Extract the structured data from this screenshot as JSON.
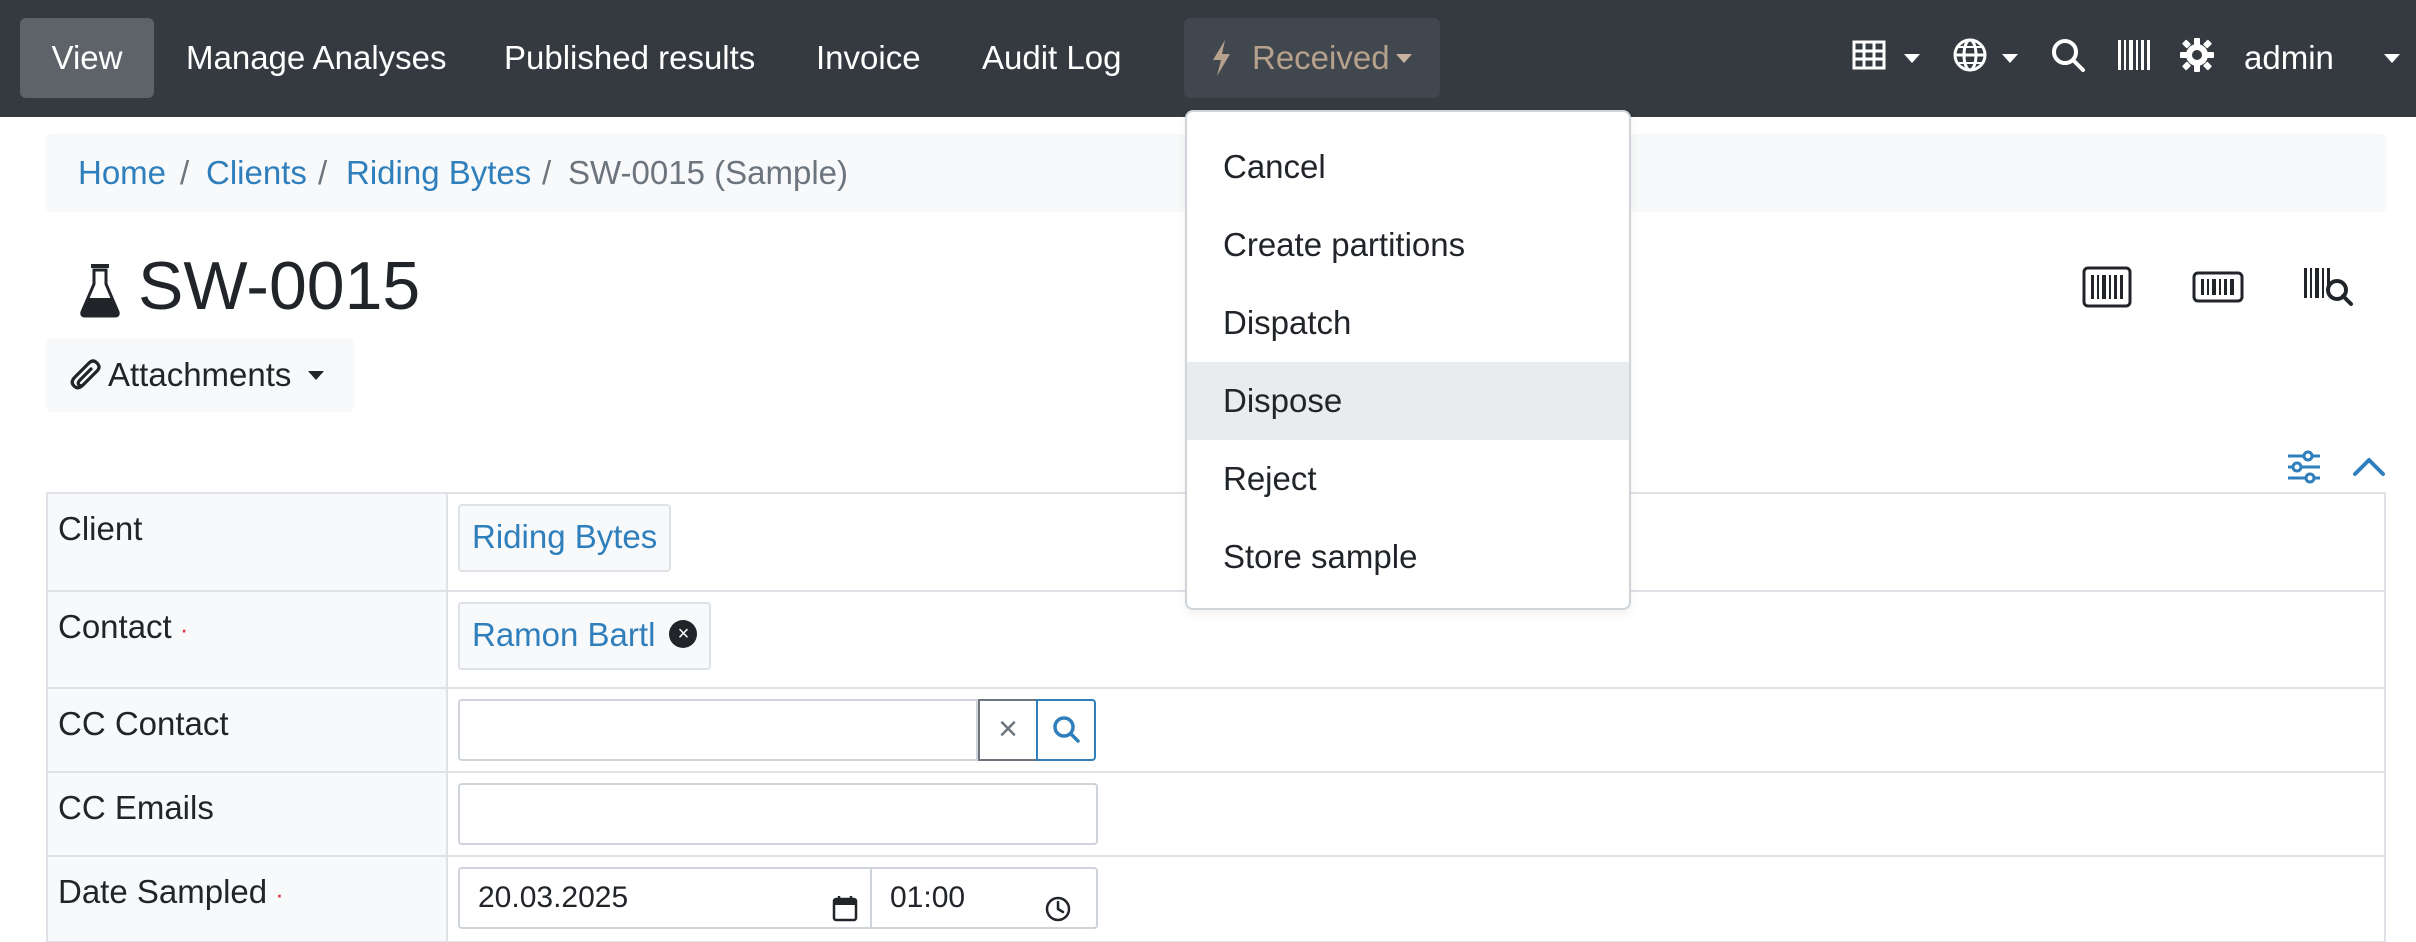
{
  "navbar": {
    "items": [
      {
        "label": "View",
        "active": true
      },
      {
        "label": "Manage Analyses"
      },
      {
        "label": "Published results"
      },
      {
        "label": "Invoice"
      },
      {
        "label": "Audit Log"
      }
    ],
    "state_button": {
      "label": "Received",
      "icon": "bolt-icon"
    },
    "icons": [
      "table-icon",
      "globe-icon",
      "search-icon",
      "barcode-icon",
      "gear-icon"
    ],
    "user": "admin"
  },
  "breadcrumb": {
    "links": [
      "Home",
      "Clients",
      "Riding Bytes"
    ],
    "current": "SW-0015 (Sample)",
    "separator": "/"
  },
  "page": {
    "title": "SW-0015",
    "title_icon": "flask-icon",
    "attachments_label": "Attachments",
    "header_icons": [
      "sticker-icon",
      "small-sticker-icon",
      "barcode-search-icon"
    ],
    "tool_icons": [
      "sliders-icon",
      "chevron-up-icon"
    ]
  },
  "form": {
    "client": {
      "label": "Client",
      "value": "Riding Bytes"
    },
    "contact": {
      "label": "Contact",
      "required_mark": "·",
      "value": "Ramon Bartl"
    },
    "cc_contact": {
      "label": "CC Contact",
      "value": "",
      "clear_symbol": "×"
    },
    "cc_emails": {
      "label": "CC Emails",
      "value": ""
    },
    "date_sampled": {
      "label": "Date Sampled",
      "required_mark": "·",
      "date": "20.03.2025",
      "time": "01:00"
    }
  },
  "dropdown": {
    "items": [
      "Cancel",
      "Create partitions",
      "Dispatch",
      "Dispose",
      "Reject",
      "Store sample"
    ],
    "highlighted": "Dispose"
  },
  "colors": {
    "navbar": "#343a40",
    "link": "#2f7fbd",
    "state_text": "#b6a18c",
    "required": "#dc3545"
  }
}
